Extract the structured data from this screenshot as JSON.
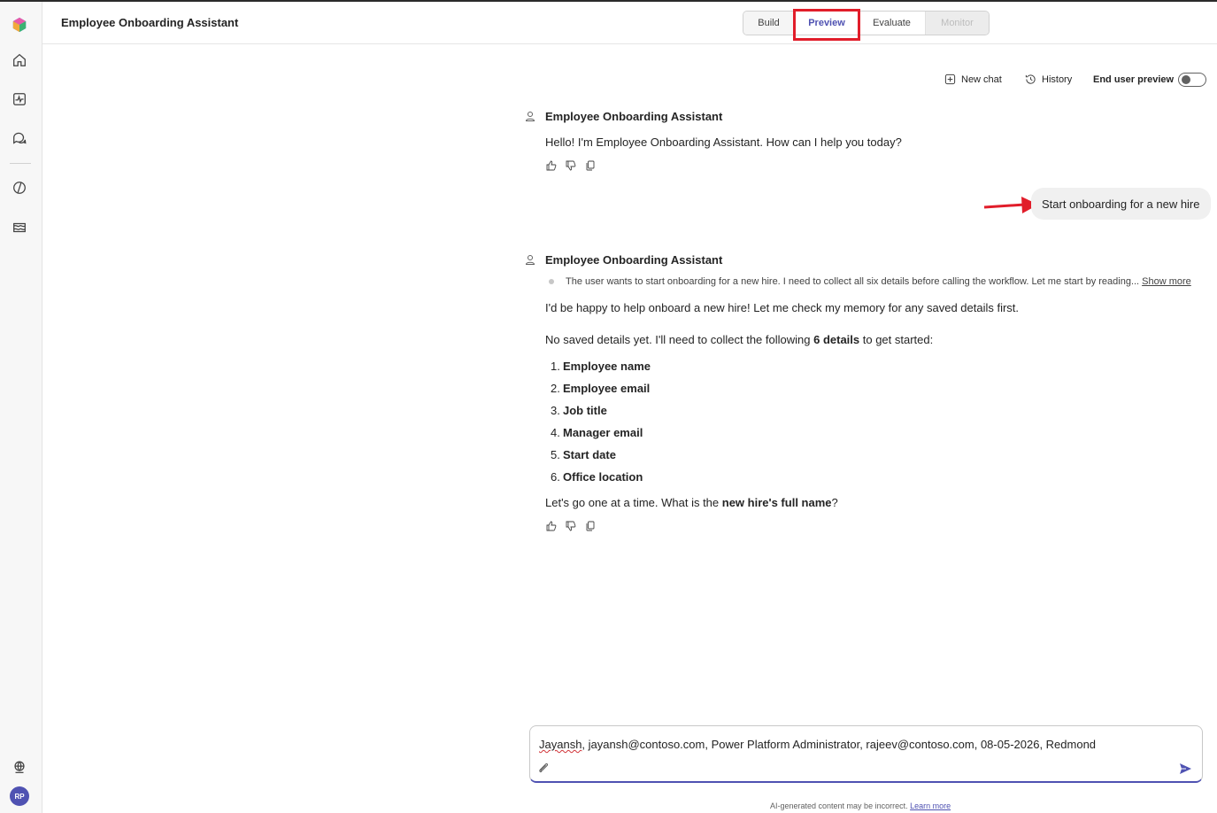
{
  "app": {
    "title": "Employee Onboarding Assistant"
  },
  "tabs": [
    {
      "label": "Build"
    },
    {
      "label": "Preview",
      "active": true
    },
    {
      "label": "Evaluate"
    },
    {
      "label": "Monitor",
      "disabled": true
    }
  ],
  "toolbar": {
    "new_chat": "New chat",
    "history": "History",
    "end_user_preview": "End user preview",
    "end_user_preview_on": false
  },
  "messages": {
    "m1": {
      "sender": "Employee Onboarding Assistant",
      "text": "Hello! I'm Employee Onboarding Assistant. How can I help you today?"
    },
    "user": {
      "text": "Start onboarding for a new hire"
    },
    "m2": {
      "sender": "Employee Onboarding Assistant",
      "reasoning": "The user wants to start onboarding for a new hire. I need to collect all six details before calling the workflow. Let me start by reading...",
      "show_more": "Show more",
      "p1": "I'd be happy to help onboard a new hire! Let me check my memory for any saved details first.",
      "p2_before": "No saved details yet. I'll need to collect the following ",
      "p2_bold": "6 details",
      "p2_after": " to get started:",
      "items": [
        {
          "num": "1.",
          "label": "Employee name"
        },
        {
          "num": "2.",
          "label": "Employee email"
        },
        {
          "num": "3.",
          "label": "Job title"
        },
        {
          "num": "4.",
          "label": "Manager email"
        },
        {
          "num": "5.",
          "label": "Start date"
        },
        {
          "num": "6.",
          "label": "Office location"
        }
      ],
      "p3_before": "Let's go one at a time. What is the ",
      "p3_bold": "new hire's full name",
      "p3_after": "?"
    }
  },
  "input": {
    "first_word": "Jayansh",
    "rest": ", jayansh@contoso.com, Power Platform Administrator, rajeev@contoso.com, 08-05-2026, Redmond"
  },
  "footer": {
    "disclaimer": "AI-generated content may be incorrect.",
    "learn_more": "Learn more"
  },
  "user": {
    "initials": "RP"
  },
  "colors": {
    "accent": "#4f52b2",
    "highlight": "#e11d2a"
  }
}
